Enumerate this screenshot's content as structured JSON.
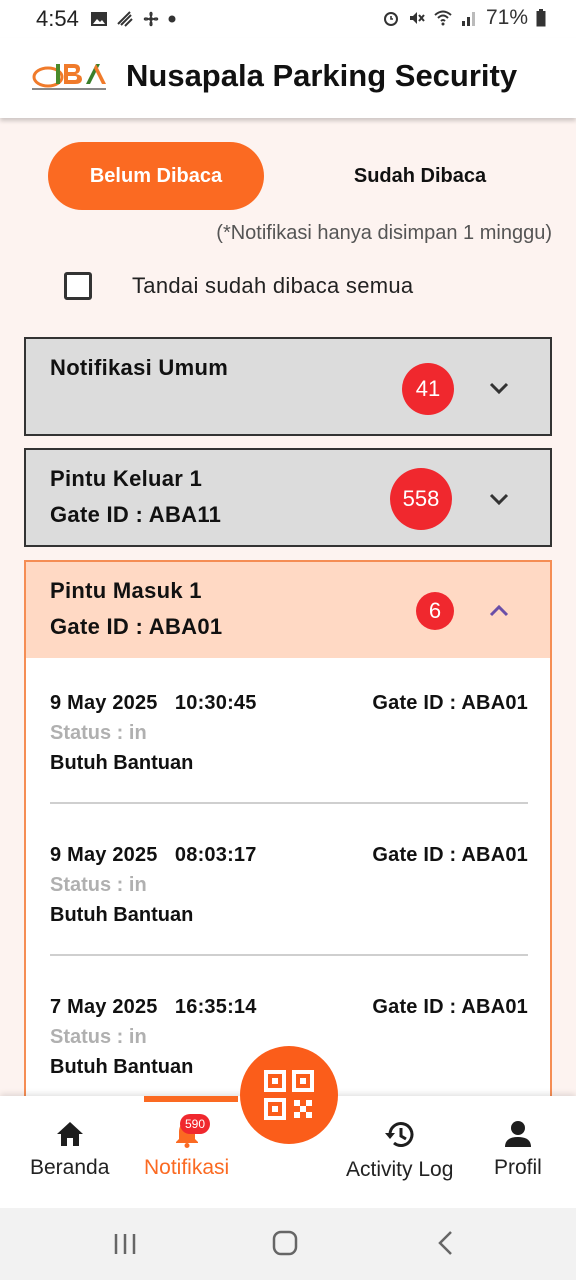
{
  "status_bar": {
    "time": "4:54",
    "battery": "71%"
  },
  "app": {
    "title": "Nusapala Parking Security"
  },
  "tabs": [
    {
      "label": "Belum Dibaca",
      "active": true
    },
    {
      "label": "Sudah Dibaca",
      "active": false
    }
  ],
  "note": "(*Notifikasi hanya disimpan 1 minggu)",
  "mark_all_label": "Tandai sudah dibaca semua",
  "groups": [
    {
      "title": "Notifikasi Umum",
      "subtitle": "",
      "count": "41",
      "expanded": false
    },
    {
      "title": "Pintu Keluar 1",
      "subtitle": "Gate ID : ABA11",
      "count": "558",
      "expanded": false
    },
    {
      "title": "Pintu Masuk 1",
      "subtitle": "Gate ID : ABA01",
      "count": "6",
      "expanded": true
    }
  ],
  "items": [
    {
      "date": "9 May 2025",
      "time": "10:30:45",
      "gate": "Gate ID : ABA01",
      "status": "Status : in",
      "desc": "Butuh Bantuan"
    },
    {
      "date": "9 May 2025",
      "time": "08:03:17",
      "gate": "Gate ID : ABA01",
      "status": "Status : in",
      "desc": "Butuh Bantuan"
    },
    {
      "date": "7 May 2025",
      "time": "16:35:14",
      "gate": "Gate ID : ABA01",
      "status": "Status : in",
      "desc": "Butuh Bantuan"
    }
  ],
  "nav": {
    "home": "Beranda",
    "notif": "Notifikasi",
    "notif_badge": "590",
    "activity": "Activity Log",
    "profile": "Profil"
  },
  "colors": {
    "accent": "#fb6a22",
    "badge": "#f0282e",
    "expanded_header": "#ffd9c4"
  }
}
